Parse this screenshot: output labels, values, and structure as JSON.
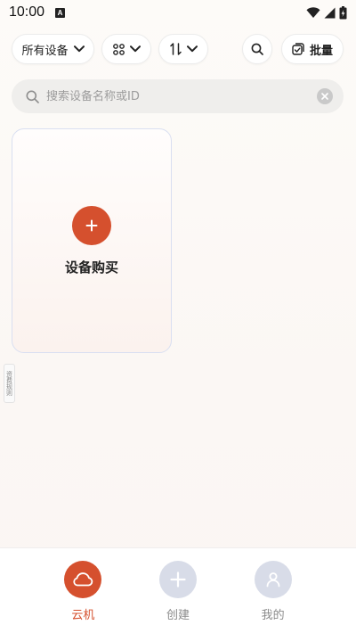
{
  "status_bar": {
    "time": "10:00",
    "app_icon_letter": "A"
  },
  "toolbar": {
    "filter_label": "所有设备",
    "batch_label": "批量"
  },
  "search": {
    "placeholder": "搜索设备名称或ID",
    "value": ""
  },
  "device_card": {
    "label": "设备购买"
  },
  "side_tab": {
    "label": "资费规则"
  },
  "bottom_nav": {
    "items": [
      {
        "label": "云机",
        "active": true
      },
      {
        "label": "创建",
        "active": false
      },
      {
        "label": "我的",
        "active": false
      }
    ]
  },
  "colors": {
    "accent": "#d5502e",
    "inactive_circle": "#d8dce8",
    "inactive_text": "#8a8a8a",
    "card_border": "#d9dff1"
  },
  "icons": [
    "wifi-icon",
    "signal-icon",
    "battery-icon",
    "chevron-down-icon",
    "grid-icon",
    "sort-icon",
    "search-icon",
    "batch-icon",
    "clear-icon",
    "plus-icon",
    "cloud-icon",
    "user-icon"
  ]
}
